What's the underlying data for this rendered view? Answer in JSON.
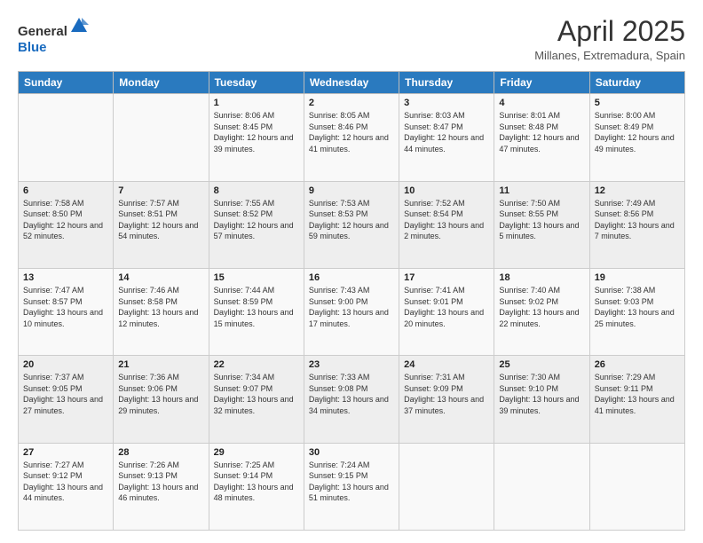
{
  "header": {
    "logo_general": "General",
    "logo_blue": "Blue",
    "title": "April 2025",
    "subtitle": "Millanes, Extremadura, Spain"
  },
  "days_of_week": [
    "Sunday",
    "Monday",
    "Tuesday",
    "Wednesday",
    "Thursday",
    "Friday",
    "Saturday"
  ],
  "weeks": [
    [
      {
        "day": "",
        "info": ""
      },
      {
        "day": "",
        "info": ""
      },
      {
        "day": "1",
        "info": "Sunrise: 8:06 AM\nSunset: 8:45 PM\nDaylight: 12 hours and 39 minutes."
      },
      {
        "day": "2",
        "info": "Sunrise: 8:05 AM\nSunset: 8:46 PM\nDaylight: 12 hours and 41 minutes."
      },
      {
        "day": "3",
        "info": "Sunrise: 8:03 AM\nSunset: 8:47 PM\nDaylight: 12 hours and 44 minutes."
      },
      {
        "day": "4",
        "info": "Sunrise: 8:01 AM\nSunset: 8:48 PM\nDaylight: 12 hours and 47 minutes."
      },
      {
        "day": "5",
        "info": "Sunrise: 8:00 AM\nSunset: 8:49 PM\nDaylight: 12 hours and 49 minutes."
      }
    ],
    [
      {
        "day": "6",
        "info": "Sunrise: 7:58 AM\nSunset: 8:50 PM\nDaylight: 12 hours and 52 minutes."
      },
      {
        "day": "7",
        "info": "Sunrise: 7:57 AM\nSunset: 8:51 PM\nDaylight: 12 hours and 54 minutes."
      },
      {
        "day": "8",
        "info": "Sunrise: 7:55 AM\nSunset: 8:52 PM\nDaylight: 12 hours and 57 minutes."
      },
      {
        "day": "9",
        "info": "Sunrise: 7:53 AM\nSunset: 8:53 PM\nDaylight: 12 hours and 59 minutes."
      },
      {
        "day": "10",
        "info": "Sunrise: 7:52 AM\nSunset: 8:54 PM\nDaylight: 13 hours and 2 minutes."
      },
      {
        "day": "11",
        "info": "Sunrise: 7:50 AM\nSunset: 8:55 PM\nDaylight: 13 hours and 5 minutes."
      },
      {
        "day": "12",
        "info": "Sunrise: 7:49 AM\nSunset: 8:56 PM\nDaylight: 13 hours and 7 minutes."
      }
    ],
    [
      {
        "day": "13",
        "info": "Sunrise: 7:47 AM\nSunset: 8:57 PM\nDaylight: 13 hours and 10 minutes."
      },
      {
        "day": "14",
        "info": "Sunrise: 7:46 AM\nSunset: 8:58 PM\nDaylight: 13 hours and 12 minutes."
      },
      {
        "day": "15",
        "info": "Sunrise: 7:44 AM\nSunset: 8:59 PM\nDaylight: 13 hours and 15 minutes."
      },
      {
        "day": "16",
        "info": "Sunrise: 7:43 AM\nSunset: 9:00 PM\nDaylight: 13 hours and 17 minutes."
      },
      {
        "day": "17",
        "info": "Sunrise: 7:41 AM\nSunset: 9:01 PM\nDaylight: 13 hours and 20 minutes."
      },
      {
        "day": "18",
        "info": "Sunrise: 7:40 AM\nSunset: 9:02 PM\nDaylight: 13 hours and 22 minutes."
      },
      {
        "day": "19",
        "info": "Sunrise: 7:38 AM\nSunset: 9:03 PM\nDaylight: 13 hours and 25 minutes."
      }
    ],
    [
      {
        "day": "20",
        "info": "Sunrise: 7:37 AM\nSunset: 9:05 PM\nDaylight: 13 hours and 27 minutes."
      },
      {
        "day": "21",
        "info": "Sunrise: 7:36 AM\nSunset: 9:06 PM\nDaylight: 13 hours and 29 minutes."
      },
      {
        "day": "22",
        "info": "Sunrise: 7:34 AM\nSunset: 9:07 PM\nDaylight: 13 hours and 32 minutes."
      },
      {
        "day": "23",
        "info": "Sunrise: 7:33 AM\nSunset: 9:08 PM\nDaylight: 13 hours and 34 minutes."
      },
      {
        "day": "24",
        "info": "Sunrise: 7:31 AM\nSunset: 9:09 PM\nDaylight: 13 hours and 37 minutes."
      },
      {
        "day": "25",
        "info": "Sunrise: 7:30 AM\nSunset: 9:10 PM\nDaylight: 13 hours and 39 minutes."
      },
      {
        "day": "26",
        "info": "Sunrise: 7:29 AM\nSunset: 9:11 PM\nDaylight: 13 hours and 41 minutes."
      }
    ],
    [
      {
        "day": "27",
        "info": "Sunrise: 7:27 AM\nSunset: 9:12 PM\nDaylight: 13 hours and 44 minutes."
      },
      {
        "day": "28",
        "info": "Sunrise: 7:26 AM\nSunset: 9:13 PM\nDaylight: 13 hours and 46 minutes."
      },
      {
        "day": "29",
        "info": "Sunrise: 7:25 AM\nSunset: 9:14 PM\nDaylight: 13 hours and 48 minutes."
      },
      {
        "day": "30",
        "info": "Sunrise: 7:24 AM\nSunset: 9:15 PM\nDaylight: 13 hours and 51 minutes."
      },
      {
        "day": "",
        "info": ""
      },
      {
        "day": "",
        "info": ""
      },
      {
        "day": "",
        "info": ""
      }
    ]
  ]
}
